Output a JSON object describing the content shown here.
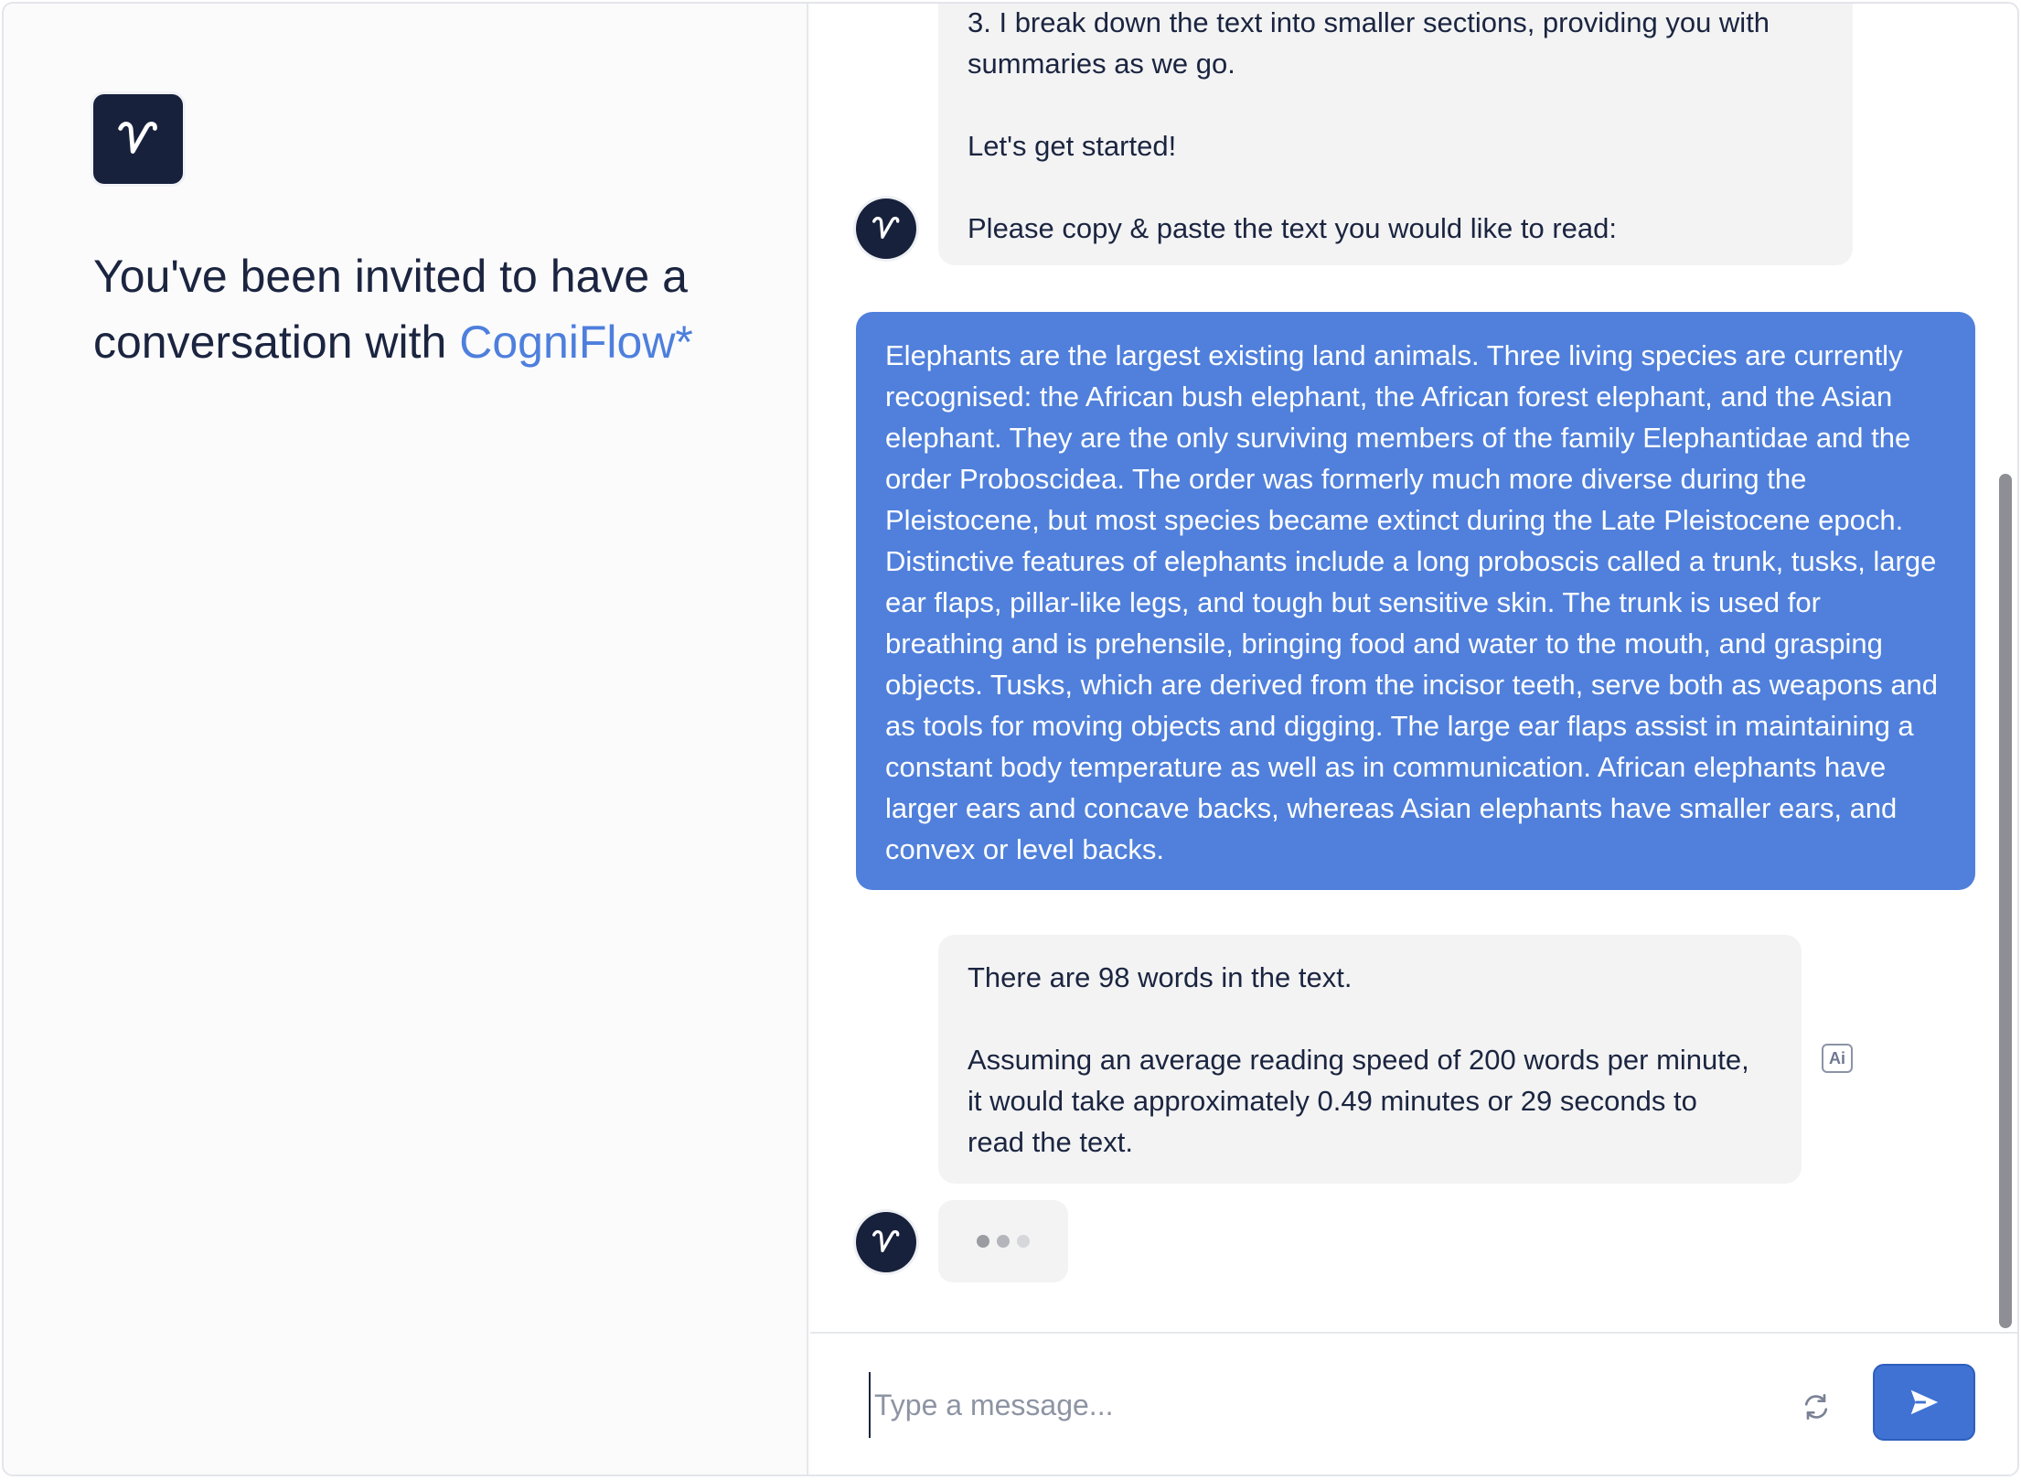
{
  "left_panel": {
    "invite_text": "You've been invited to have a conversation with",
    "brand_name": "CogniFlow*",
    "logo_letter": "v"
  },
  "chat": {
    "messages": [
      {
        "role": "bot",
        "lines": [
          "3. I break down the text into smaller sections, providing you with",
          "summaries as we go.",
          "",
          "Let's get started!",
          "",
          "Please copy & paste the text you would like to read:"
        ]
      },
      {
        "role": "user",
        "text": "Elephants are the largest existing land animals. Three living species are currently recognised: the African bush elephant, the African forest elephant, and the Asian elephant. They are the only surviving members of the family Elephantidae and the order Proboscidea. The order was formerly much more diverse during the Pleistocene, but most species became extinct during the Late Pleistocene epoch. Distinctive features of elephants include a long proboscis called a trunk, tusks, large ear flaps, pillar-like legs, and tough but sensitive skin. The trunk is used for breathing and is prehensile, bringing food and water to the mouth, and grasping objects. Tusks, which are derived from the incisor teeth, serve both as weapons and as tools for moving objects and digging. The large ear flaps assist in maintaining a constant body temperature as well as in communication. African elephants have larger ears and concave backs, whereas Asian elephants have smaller ears, and convex or level backs."
      },
      {
        "role": "bot",
        "lines": [
          "There are 98 words in the text.",
          "",
          "Assuming an average reading speed of 200 words per minute,",
          "it would take approximately 0.49 minutes or 29 seconds to",
          "read the text."
        ]
      }
    ],
    "ai_badge": "Ai"
  },
  "composer": {
    "placeholder": "Type a message..."
  },
  "colors": {
    "accent": "#5080dc",
    "brand_dark": "#17213c",
    "send_button": "#3f72d3"
  }
}
